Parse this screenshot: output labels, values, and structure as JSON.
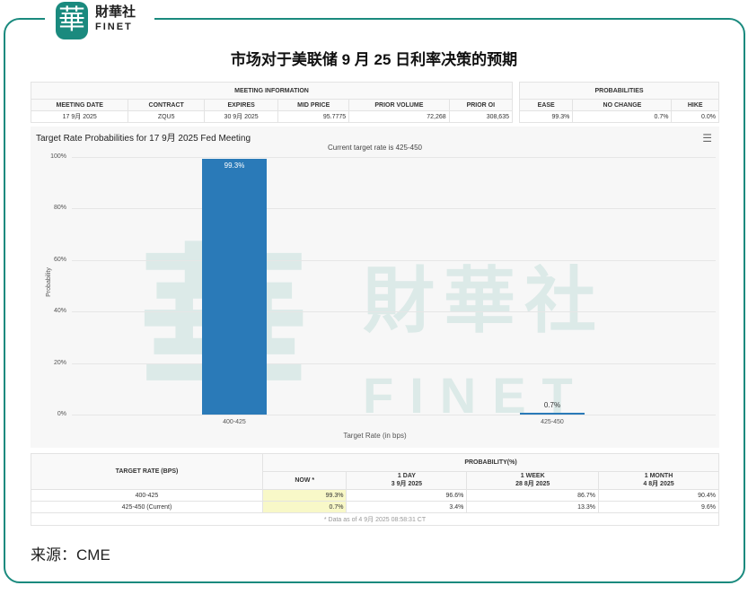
{
  "brand": {
    "logo_char": "華",
    "name_cn": "財華社",
    "name_en": "FINET"
  },
  "title": "市场对于美联储 9 月 25 日利率决策的预期",
  "meeting": {
    "header": "MEETING INFORMATION",
    "cols": [
      "MEETING DATE",
      "CONTRACT",
      "EXPIRES",
      "MID PRICE",
      "PRIOR VOLUME",
      "PRIOR OI"
    ],
    "values": [
      "17 9月 2025",
      "ZQU5",
      "30 9月 2025",
      "95.7775",
      "72,268",
      "308,635"
    ]
  },
  "probs": {
    "header": "PROBABILITIES",
    "cols": [
      "EASE",
      "NO CHANGE",
      "HIKE"
    ],
    "values": [
      "99.3%",
      "0.7%",
      "0.0%"
    ]
  },
  "chart_data": {
    "type": "bar",
    "title": "Target Rate Probabilities for 17 9月 2025 Fed Meeting",
    "subtitle": "Current target rate is 425-450",
    "xlabel": "Target Rate (in bps)",
    "ylabel": "Probability",
    "categories": [
      "400-425",
      "425-450"
    ],
    "values": [
      99.3,
      0.7
    ],
    "data_labels": [
      "99.3%",
      "0.7%"
    ],
    "yticks": [
      "0%",
      "20%",
      "40%",
      "60%",
      "80%",
      "100%"
    ],
    "ylim": [
      0,
      100
    ],
    "color": "#2a7ab8"
  },
  "bottom": {
    "rate_header": "TARGET RATE (BPS)",
    "prob_header": "PROBABILITY(%)",
    "cols": [
      {
        "l1": "NOW *",
        "l2": ""
      },
      {
        "l1": "1 DAY",
        "l2": "3 9月 2025"
      },
      {
        "l1": "1 WEEK",
        "l2": "28 8月 2025"
      },
      {
        "l1": "1 MONTH",
        "l2": "4 8月 2025"
      }
    ],
    "rows": [
      {
        "rate": "400-425",
        "v": [
          "99.3%",
          "96.6%",
          "86.7%",
          "90.4%"
        ]
      },
      {
        "rate": "425-450 (Current)",
        "v": [
          "0.7%",
          "3.4%",
          "13.3%",
          "9.6%"
        ]
      }
    ],
    "note": "* Data as of 4 9月 2025 08:58:31 CT"
  },
  "source": "来源：CME"
}
